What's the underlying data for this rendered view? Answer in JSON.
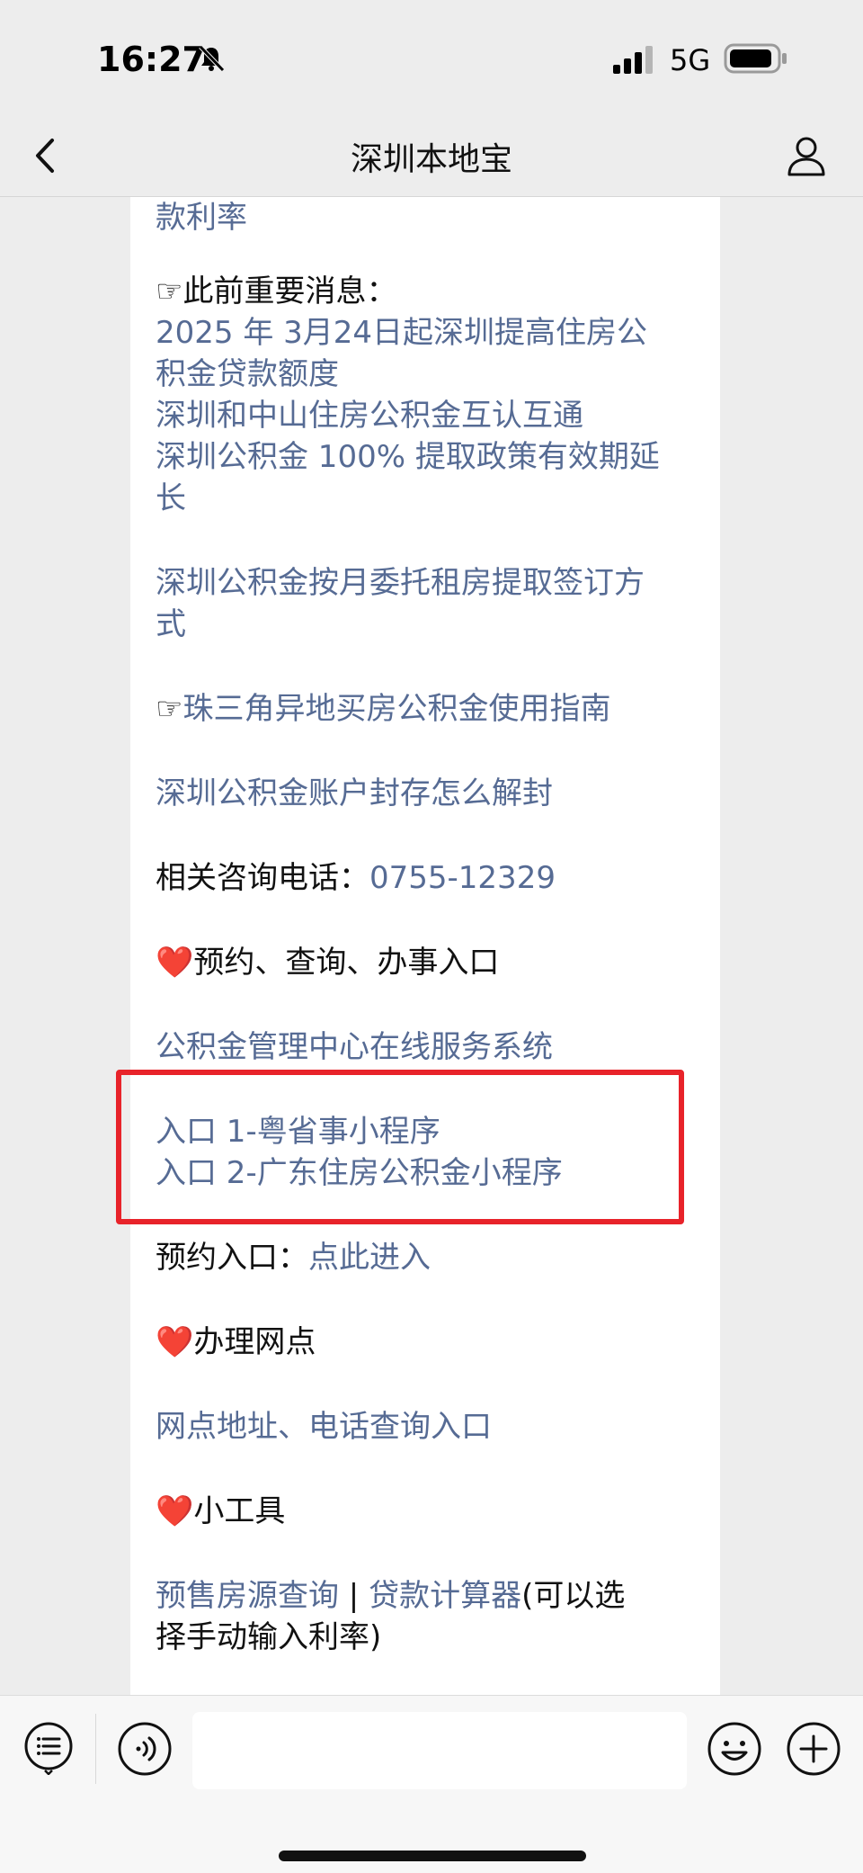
{
  "status_bar": {
    "time": "16:27",
    "network": "5G"
  },
  "nav": {
    "title": "深圳本地宝"
  },
  "article": {
    "line_top_partial": "款利率",
    "prev_news_heading": "☞此前重要消息：",
    "news_links": [
      "2025 年 3月24日起深圳提高住房公",
      "积金贷款额度",
      "深圳和中山住房公积金互认互通",
      "深圳公积金 100% 提取政策有效期延",
      "长"
    ],
    "rent_link_line1": "深圳公积金按月委托租房提取签订方",
    "rent_link_line2": "式",
    "prd_guide_prefix": "☞",
    "prd_guide_link": "珠三角异地买房公积金使用指南",
    "unseal_link": "深圳公积金账户封存怎么解封",
    "hotline_label": "相关咨询电话：",
    "hotline_number": "0755-12329",
    "section_appointment": "预约、查询、办事入口",
    "online_service_link": "公积金管理中心在线服务系统",
    "entry1_link": "入口 1-粤省事小程序",
    "entry2_link": "入口 2-广东住房公积金小程序",
    "appointment_label": "预约入口：",
    "appointment_link": "点此进入",
    "section_outlets": "办理网点",
    "outlets_link": "网点地址、电话查询入口",
    "section_tools": "小工具",
    "presale_link": "预售房源查询",
    "tools_separator": " | ",
    "loan_calc_link": "贷款计算器",
    "loan_calc_note": "(可以选",
    "loan_calc_note2": "择手动输入利率)",
    "heart_symbol": "❤️"
  },
  "colors": {
    "link": "#566b94",
    "highlight_border": "#e8232a",
    "heart": "#e0202b"
  }
}
